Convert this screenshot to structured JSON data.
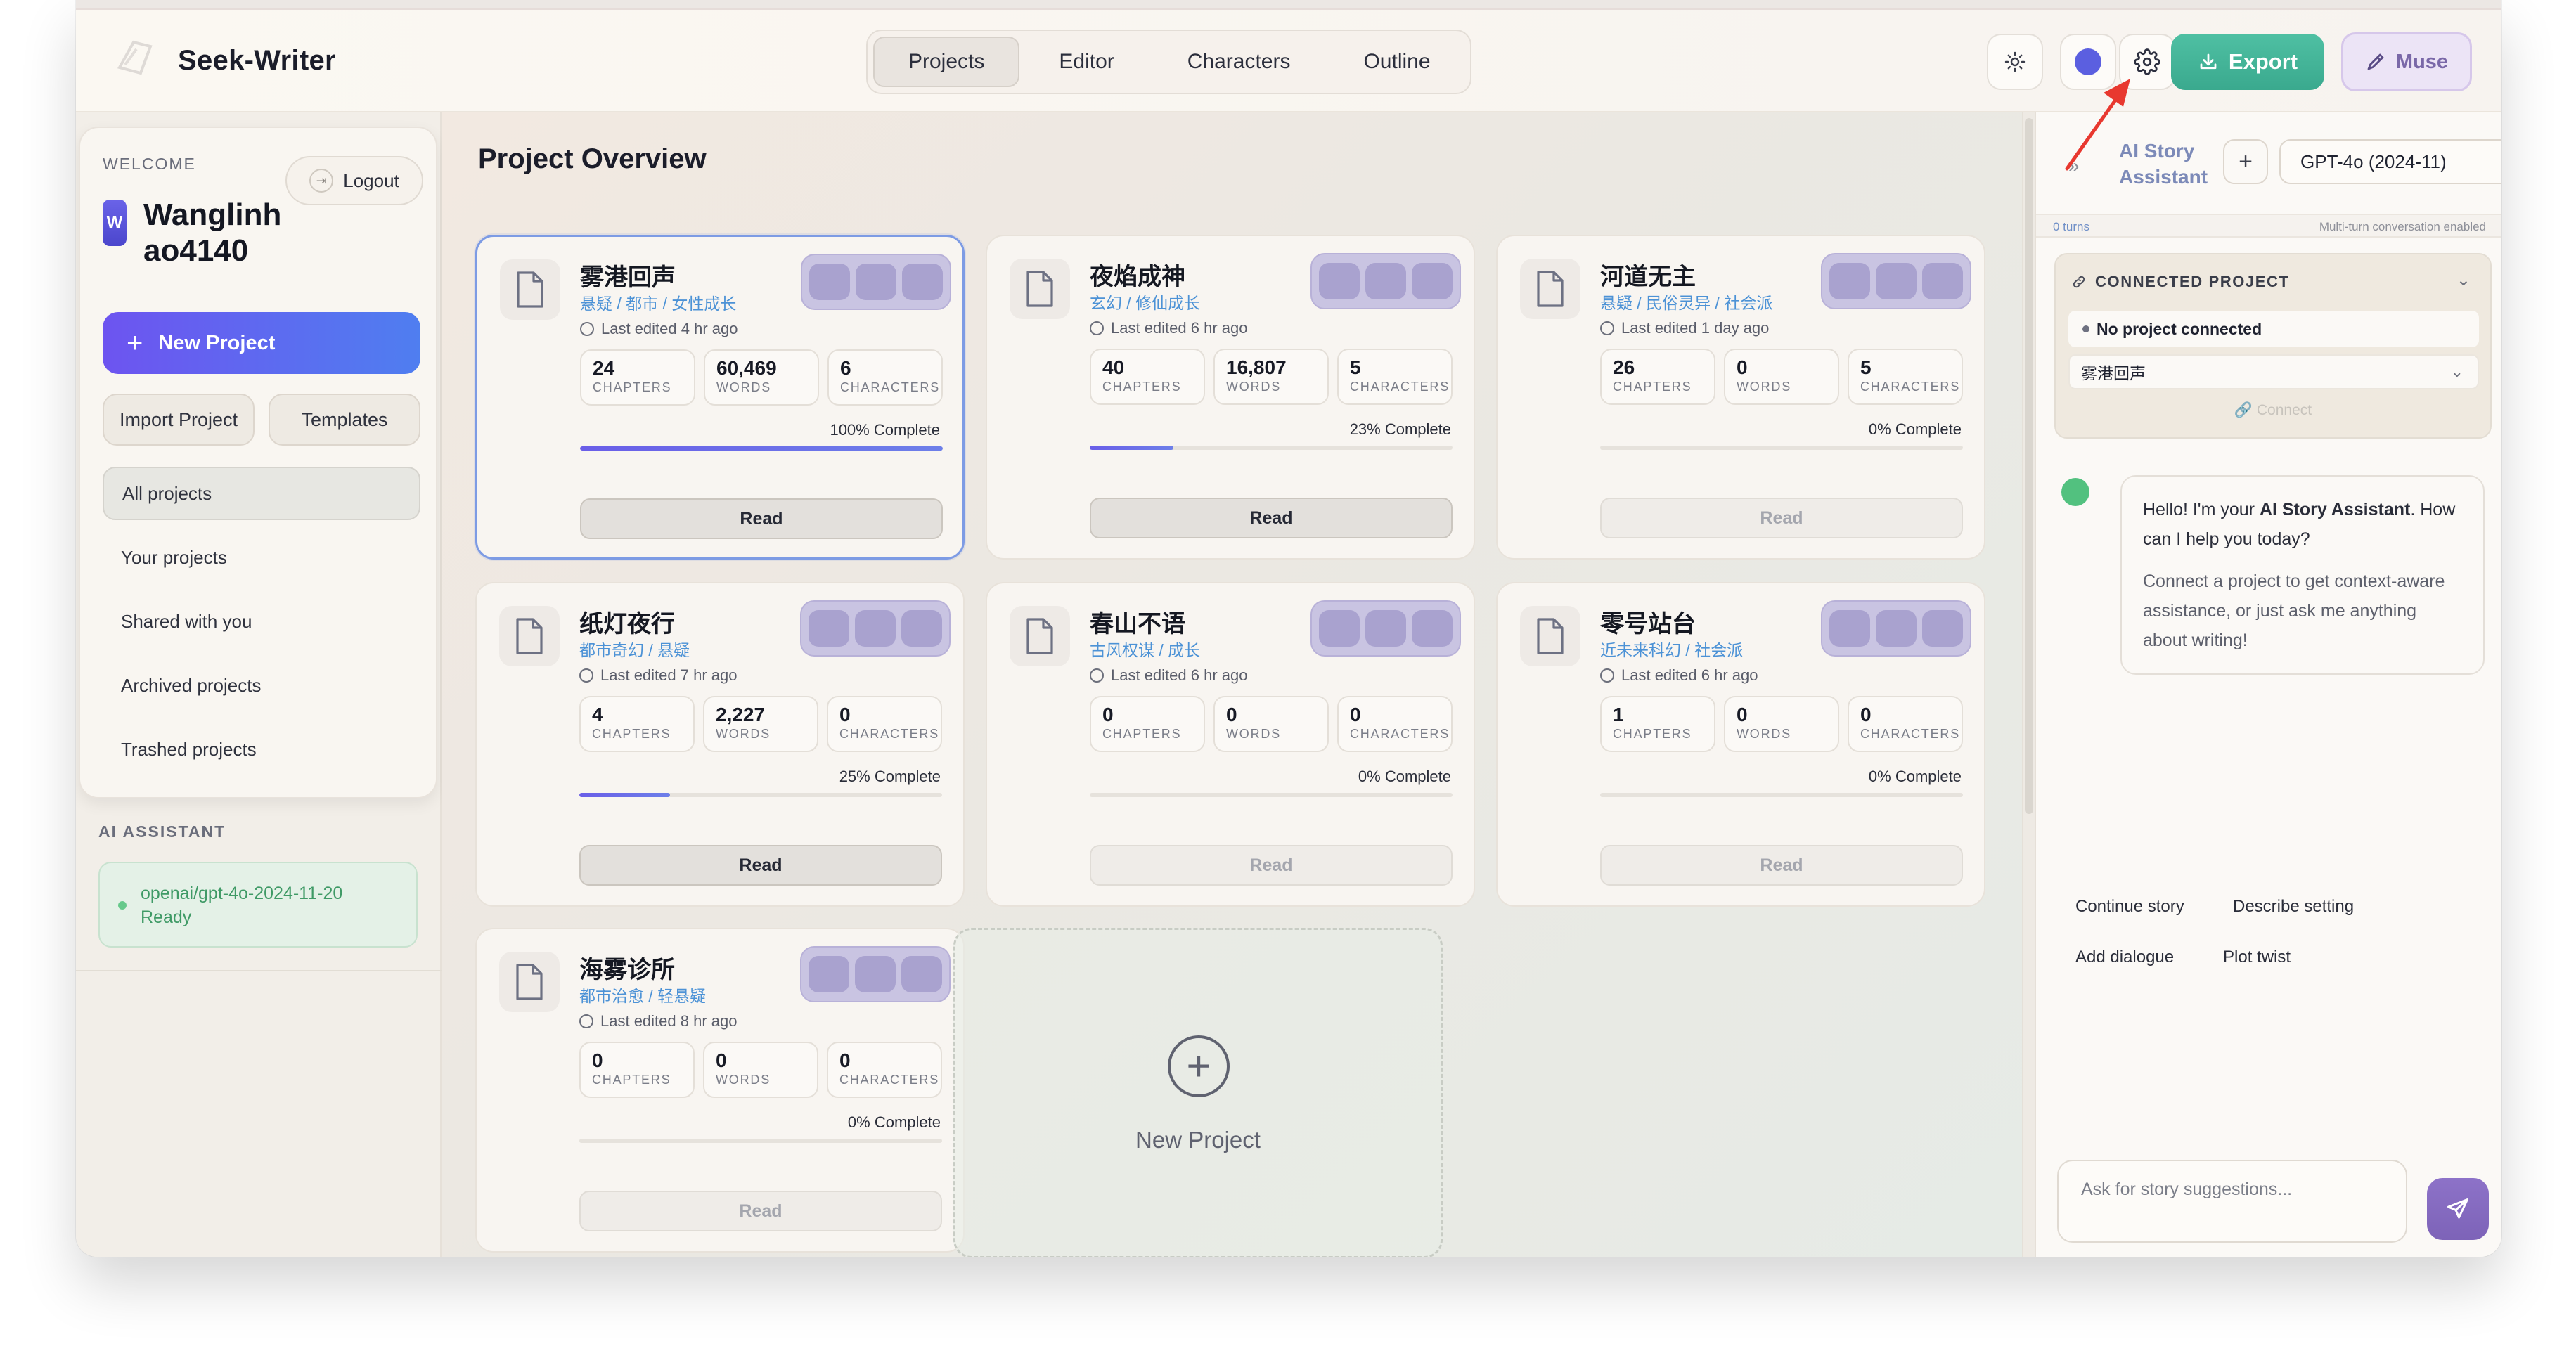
{
  "app": {
    "title": "Seek-Writer"
  },
  "nav_tabs": [
    {
      "label": "Projects"
    },
    {
      "label": "Editor"
    },
    {
      "label": "Characters"
    },
    {
      "label": "Outline"
    }
  ],
  "header": {
    "export_label": "Export",
    "muse_label": "Muse",
    "accent_color": "#5b5fe0",
    "export_color": "#45b597",
    "icons": [
      "sun-icon",
      "color-dot-icon",
      "gear-icon",
      "download-icon",
      "brush-icon"
    ]
  },
  "sidebar": {
    "welcome_label": "WELCOME",
    "avatar_letter": "W",
    "username": "Wanglinhao4140",
    "logout_label": "Logout",
    "new_project_label": "New Project",
    "import_label": "Import Project",
    "templates_label": "Templates",
    "items": [
      {
        "label": "All projects"
      },
      {
        "label": "Your projects"
      },
      {
        "label": "Shared with you"
      },
      {
        "label": "Archived projects"
      },
      {
        "label": "Trashed projects"
      }
    ],
    "ai_label": "AI ASSISTANT",
    "ai_model": "openai/gpt-4o-2024-11-20",
    "ai_status": "Ready"
  },
  "main": {
    "title": "Project Overview",
    "read_label": "Read",
    "new_project_label": "New Project",
    "stat_labels": {
      "chapters": "CHAPTERS",
      "words": "WORDS",
      "characters": "CHARACTERS"
    },
    "projects": [
      {
        "title": "雾港回声",
        "genre": "悬疑 / 都市 / 女性成长",
        "edited": "Last edited 4 hr ago",
        "chapters": "24",
        "words": "60,469",
        "characters": "6",
        "pct": "100% Complete",
        "progress": 1.0
      },
      {
        "title": "夜焰成神",
        "genre": "玄幻 / 修仙成长",
        "edited": "Last edited 6 hr ago",
        "chapters": "40",
        "words": "16,807",
        "characters": "5",
        "pct": "23% Complete",
        "progress": 0.23
      },
      {
        "title": "河道无主",
        "genre": "悬疑 / 民俗灵异 / 社会派",
        "edited": "Last edited 1 day ago",
        "chapters": "26",
        "words": "0",
        "characters": "5",
        "pct": "0% Complete",
        "progress": 0
      },
      {
        "title": "纸灯夜行",
        "genre": "都市奇幻 / 悬疑",
        "edited": "Last edited 7 hr ago",
        "chapters": "4",
        "words": "2,227",
        "characters": "0",
        "pct": "25% Complete",
        "progress": 0.25
      },
      {
        "title": "春山不语",
        "genre": "古风权谋 / 成长",
        "edited": "Last edited 6 hr ago",
        "chapters": "0",
        "words": "0",
        "characters": "0",
        "pct": "0% Complete",
        "progress": 0
      },
      {
        "title": "零号站台",
        "genre": "近未来科幻 / 社会派",
        "edited": "Last edited 6 hr ago",
        "chapters": "1",
        "words": "0",
        "characters": "0",
        "pct": "0% Complete",
        "progress": 0
      },
      {
        "title": "海雾诊所",
        "genre": "都市治愈 / 轻悬疑",
        "edited": "Last edited 8 hr ago",
        "chapters": "0",
        "words": "0",
        "characters": "0",
        "pct": "0% Complete",
        "progress": 0
      }
    ]
  },
  "assistant": {
    "title": "AI Story Assistant",
    "model_select": "GPT-4o (2024-11)",
    "turns": "0 turns",
    "multi_turn": "Multi-turn conversation enabled",
    "connected_header": "CONNECTED PROJECT",
    "no_project": "No project connected",
    "project_select": "雾港回声",
    "connect_label": "Connect",
    "greeting_pre": "Hello! I'm your ",
    "greeting_bold": "AI Story Assistant",
    "greeting_post": ". How can I help you today?",
    "greeting_sub": "Connect a project to get context-aware assistance, or just ask me anything about writing!",
    "suggestions": [
      "Continue story",
      "Describe setting",
      "Add dialogue",
      "Plot twist"
    ],
    "input_placeholder": "Ask for story suggestions..."
  }
}
